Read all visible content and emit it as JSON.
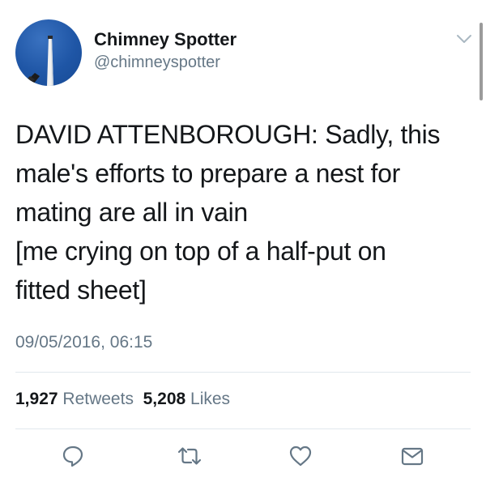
{
  "user": {
    "display_name": "Chimney Spotter",
    "handle": "@chimneyspotter",
    "avatar_icon": "chimney-photo-avatar"
  },
  "tweet": {
    "lines": [
      "DAVID ATTENBOROUGH: Sadly, this",
      "male's efforts to prepare a nest for",
      "mating are all in vain",
      "[me crying on top of a half-put on",
      "fitted sheet]"
    ],
    "timestamp": "09/05/2016, 06:15"
  },
  "stats": {
    "retweets_count": "1,927",
    "retweets_label": "Retweets",
    "likes_count": "5,208",
    "likes_label": "Likes"
  },
  "actions": {
    "reply_icon": "reply-icon",
    "retweet_icon": "retweet-icon",
    "like_icon": "heart-icon",
    "dm_icon": "envelope-icon"
  },
  "colors": {
    "text_primary": "#14171a",
    "text_secondary": "#657786",
    "divider": "#e1e8ed",
    "avatar_blue": "#1f56a6"
  }
}
